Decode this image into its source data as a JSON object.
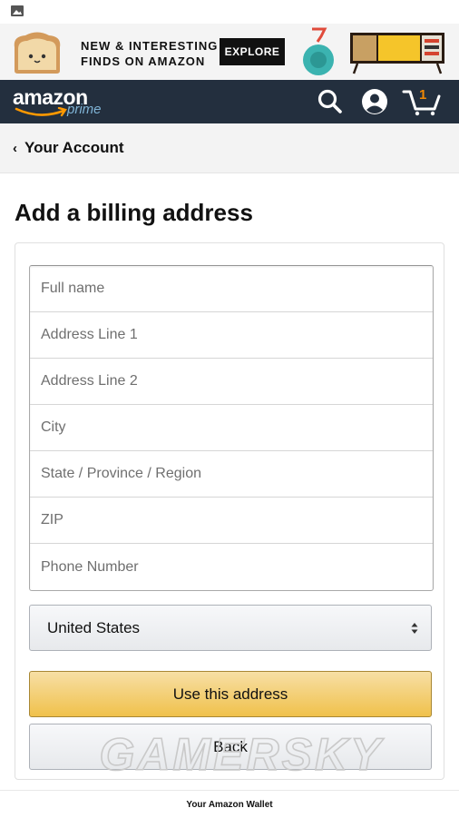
{
  "status_bar": {
    "image_icon": "image-icon"
  },
  "ad_banner": {
    "line1": "NEW & INTERESTING",
    "line2": "FINDS ON AMAZON",
    "button_label": "EXPLORE"
  },
  "nav": {
    "logo_text": "amazon",
    "logo_sub": "prime",
    "cart_count": "1",
    "icons": [
      "search-icon",
      "account-icon",
      "cart-icon"
    ],
    "background": "#232f3e"
  },
  "account_bar": {
    "back_label": "Your Account"
  },
  "page": {
    "title": "Add a billing address"
  },
  "form": {
    "fields": [
      {
        "placeholder": "Full name",
        "value": ""
      },
      {
        "placeholder": "Address Line 1",
        "value": ""
      },
      {
        "placeholder": "Address Line 2",
        "value": ""
      },
      {
        "placeholder": "City",
        "value": ""
      },
      {
        "placeholder": "State / Province / Region",
        "value": ""
      },
      {
        "placeholder": "ZIP",
        "value": ""
      },
      {
        "placeholder": "Phone Number",
        "value": ""
      }
    ],
    "country": "United States",
    "primary_button": "Use this address",
    "secondary_button": "Back",
    "primary_color": "#f0c14b"
  },
  "watermark": "GAMERSKY",
  "footer": {
    "text": "Your Amazon Wallet"
  }
}
